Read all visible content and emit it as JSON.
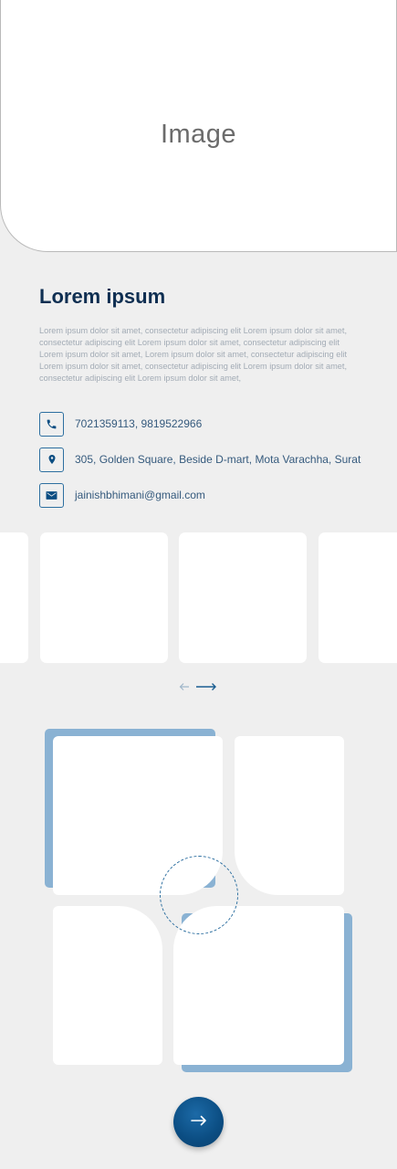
{
  "hero": {
    "placeholder": "Image"
  },
  "profile": {
    "title": "Lorem ipsum",
    "description": "Lorem ipsum dolor sit amet, consectetur adipiscing elit Lorem ipsum dolor sit amet, consectetur adipiscing elit Lorem ipsum dolor sit amet, consectetur adipiscing elit Lorem ipsum dolor sit amet, Lorem ipsum dolor sit amet, consectetur adipiscing elit Lorem ipsum dolor sit amet, consectetur adipiscing elit Lorem ipsum dolor sit amet, consectetur adipiscing elit Lorem ipsum dolor sit amet,"
  },
  "contacts": [
    {
      "icon": "phone-icon",
      "text": "7021359113, 9819522966"
    },
    {
      "icon": "location-pin-icon",
      "text": "305, Golden Square, Beside D-mart, Mota Varachha, Surat"
    },
    {
      "icon": "mail-icon",
      "text": "jainishbhimani@gmail.com"
    }
  ],
  "carousel": {
    "prev_icon": "arrow-left-icon",
    "next_icon": "arrow-right-icon"
  },
  "colors": {
    "accent": "#0b4d82",
    "title": "#0f2f52",
    "shadow_tile": "#8ab2d3",
    "background": "#efefef"
  },
  "next_button": {
    "icon": "arrow-right-icon"
  }
}
